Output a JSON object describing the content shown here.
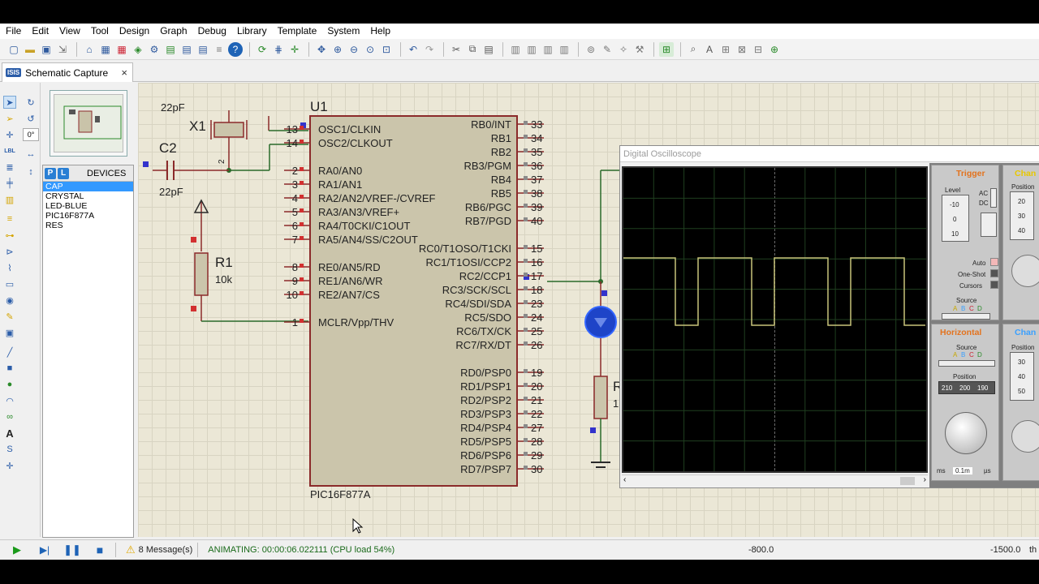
{
  "menu": [
    "File",
    "Edit",
    "View",
    "Tool",
    "Design",
    "Graph",
    "Debug",
    "Library",
    "Template",
    "System",
    "Help"
  ],
  "tab": {
    "label": "Schematic Capture",
    "badge": "ISIS"
  },
  "left": {
    "angle": "0°"
  },
  "devices": {
    "p_btn": "P",
    "l_btn": "L",
    "title": "DEVICES",
    "items": [
      "CAP",
      "CRYSTAL",
      "LED-BLUE",
      "PIC16F877A",
      "RES"
    ]
  },
  "schematic": {
    "chip_name": "PIC16F877A",
    "top_cut_label": "22pF",
    "top_u1": "U1",
    "x1": "X1",
    "x1_pin": "2",
    "c2": "C2",
    "c2_val": "22pF",
    "r1": "R1",
    "r1_val": "10k",
    "r2": "R",
    "r2_val": "1",
    "left_pins": [
      {
        "n": "13",
        "l": "OSC1/CLKIN"
      },
      {
        "n": "14",
        "l": "OSC2/CLKOUT"
      },
      {
        "n": "2",
        "l": "RA0/AN0"
      },
      {
        "n": "3",
        "l": "RA1/AN1"
      },
      {
        "n": "4",
        "l": "RA2/AN2/VREF-/CVREF"
      },
      {
        "n": "5",
        "l": "RA3/AN3/VREF+"
      },
      {
        "n": "6",
        "l": "RA4/T0CKI/C1OUT"
      },
      {
        "n": "7",
        "l": "RA5/AN4/SS/C2OUT"
      },
      {
        "n": "8",
        "l": "RE0/AN5/RD"
      },
      {
        "n": "9",
        "l": "RE1/AN6/WR"
      },
      {
        "n": "10",
        "l": "RE2/AN7/CS"
      },
      {
        "n": "1",
        "l": "MCLR/Vpp/THV"
      }
    ],
    "right_pins": [
      {
        "n": "33",
        "l": "RB0/INT"
      },
      {
        "n": "34",
        "l": "RB1"
      },
      {
        "n": "35",
        "l": "RB2"
      },
      {
        "n": "36",
        "l": "RB3/PGM"
      },
      {
        "n": "37",
        "l": "RB4"
      },
      {
        "n": "38",
        "l": "RB5"
      },
      {
        "n": "39",
        "l": "RB6/PGC"
      },
      {
        "n": "40",
        "l": "RB7/PGD"
      },
      {
        "n": "15",
        "l": "RC0/T1OSO/T1CKI"
      },
      {
        "n": "16",
        "l": "RC1/T1OSI/CCP2"
      },
      {
        "n": "17",
        "l": "RC2/CCP1"
      },
      {
        "n": "18",
        "l": "RC3/SCK/SCL"
      },
      {
        "n": "23",
        "l": "RC4/SDI/SDA"
      },
      {
        "n": "24",
        "l": "RC5/SDO"
      },
      {
        "n": "25",
        "l": "RC6/TX/CK"
      },
      {
        "n": "26",
        "l": "RC7/RX/DT"
      },
      {
        "n": "19",
        "l": "RD0/PSP0"
      },
      {
        "n": "20",
        "l": "RD1/PSP1"
      },
      {
        "n": "21",
        "l": "RD2/PSP2"
      },
      {
        "n": "22",
        "l": "RD3/PSP3"
      },
      {
        "n": "27",
        "l": "RD4/PSP4"
      },
      {
        "n": "28",
        "l": "RD5/PSP5"
      },
      {
        "n": "29",
        "l": "RD6/PSP6"
      },
      {
        "n": "30",
        "l": "RD7/PSP7"
      }
    ]
  },
  "scope": {
    "title": "Digital Oscilloscope",
    "trigger": {
      "title": "Trigger",
      "level": "Level",
      "ac": "AC",
      "dc": "DC",
      "auto": "Auto",
      "oneshot": "One-Shot",
      "cursors": "Cursors",
      "source": "Source",
      "sources": [
        "A",
        "B",
        "C",
        "D"
      ]
    },
    "channel_a": {
      "title": "Chan",
      "position": "Position",
      "scale": [
        "20",
        "30",
        "40"
      ]
    },
    "level_scale": [
      "-10",
      "0",
      "10"
    ],
    "horizontal": {
      "title": "Horizontal",
      "source": "Source",
      "sources": [
        "A",
        "B",
        "C",
        "D"
      ],
      "position": "Position",
      "pos_scale": [
        "210",
        "200",
        "190"
      ],
      "ms": "ms",
      "range": "0.1m",
      "us": "µs"
    },
    "channel_b": {
      "title": "Chan",
      "position": "Position",
      "scale": [
        "30",
        "40",
        "50"
      ]
    },
    "colors": {
      "trace": "#c8c47a",
      "trigger": "#e3731e",
      "chan": "#e8c800",
      "channel_b": "#3aa0ff"
    }
  },
  "status": {
    "messages": "8 Message(s)",
    "animating": "ANIMATING: 00:00:06.022111 (CPU load 54%)",
    "coord_x": "-800.0",
    "coord_y": "-1500.0",
    "tail": "th"
  }
}
